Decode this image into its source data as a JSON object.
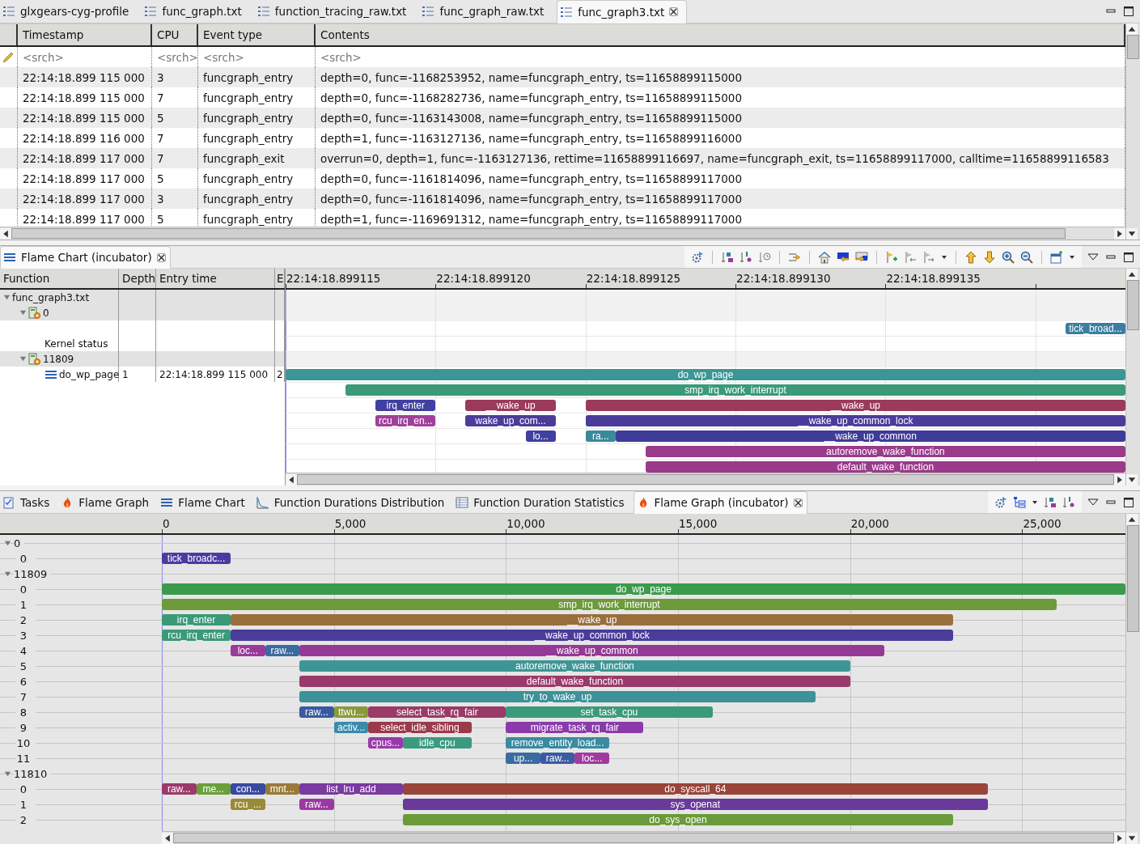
{
  "editor_tabs": [
    {
      "label": "glxgears-cyg-profile",
      "selected": false
    },
    {
      "label": "func_graph.txt",
      "selected": false
    },
    {
      "label": "function_tracing_raw.txt",
      "selected": false
    },
    {
      "label": "func_graph_raw.txt",
      "selected": false
    },
    {
      "label": "func_graph3.txt",
      "selected": true
    }
  ],
  "events_table": {
    "columns": [
      "Timestamp",
      "CPU",
      "Event type",
      "Contents"
    ],
    "filters": [
      "<srch>",
      "<srch>",
      "<srch>",
      "<srch>"
    ],
    "rows": [
      {
        "cells": [
          "22:14:18.899 115 000",
          "3",
          "funcgraph_entry",
          "depth=0, func=-1168253952, name=funcgraph_entry, ts=11658899115000"
        ]
      },
      {
        "cells": [
          "22:14:18.899 115 000",
          "7",
          "funcgraph_entry",
          "depth=0, func=-1168282736, name=funcgraph_entry, ts=11658899115000"
        ]
      },
      {
        "cells": [
          "22:14:18.899 115 000",
          "5",
          "funcgraph_entry",
          "depth=0, func=-1163143008, name=funcgraph_entry, ts=11658899115000"
        ]
      },
      {
        "cells": [
          "22:14:18.899 116 000",
          "7",
          "funcgraph_entry",
          "depth=1, func=-1163127136, name=funcgraph_entry, ts=11658899116000"
        ]
      },
      {
        "cells": [
          "22:14:18.899 117 000",
          "7",
          "funcgraph_exit",
          "overrun=0, depth=1, func=-1163127136, rettime=11658899116697, name=funcgraph_exit, ts=11658899117000, calltime=11658899116583"
        ]
      },
      {
        "cells": [
          "22:14:18.899 117 000",
          "5",
          "funcgraph_entry",
          "depth=0, func=-1161814096, name=funcgraph_entry, ts=11658899117000"
        ]
      },
      {
        "cells": [
          "22:14:18.899 117 000",
          "3",
          "funcgraph_entry",
          "depth=0, func=-1161814096, name=funcgraph_entry, ts=11658899117000"
        ]
      },
      {
        "cells": [
          "22:14:18.899 117 000",
          "5",
          "funcgraph_entry",
          "depth=1, func=-1169691312, name=funcgraph_entry, ts=11658899117000"
        ]
      }
    ]
  },
  "flame_chart_view": {
    "tab": {
      "label": "Flame Chart (incubator)",
      "selected": true
    },
    "columns": [
      "Function",
      "Depth",
      "Entry time",
      "E"
    ],
    "tree": [
      {
        "label": "func_graph3.txt",
        "kind": "trace",
        "expanded": true,
        "children": [
          {
            "label": "0",
            "kind": "thread",
            "expanded": true,
            "children": [
              {
                "label": "Kernel status",
                "kind": "status"
              }
            ]
          },
          {
            "label": "11809",
            "kind": "thread",
            "expanded": true,
            "children": [
              {
                "label": "do_wp_page",
                "kind": "function",
                "depth": "1",
                "entry_time": "22:14:18.899 115 000",
                "column_4": "2"
              }
            ]
          }
        ]
      }
    ],
    "timeline": {
      "ticks": [
        "22:14:18.899115",
        "22:14:18.899120",
        "22:14:18.899125",
        "22:14:18.899130",
        "22:14:18.899135"
      ],
      "rows": [
        {
          "kind": "group",
          "bars": []
        },
        {
          "kind": "group",
          "bars": []
        },
        {
          "kind": "plain",
          "bars": [
            {
              "label": "tick_broad...",
              "color": "#3b7ea1"
            }
          ]
        },
        {
          "kind": "plain",
          "bars": []
        },
        {
          "kind": "group",
          "bars": []
        },
        {
          "kind": "plain",
          "bars": [
            {
              "label": "do_wp_page",
              "color": "#3d9695"
            }
          ]
        },
        {
          "kind": "plain",
          "bars": [
            {
              "label": "smp_irq_work_interrupt",
              "color": "#3b9a78"
            }
          ]
        },
        {
          "kind": "plain",
          "bars": [
            {
              "label": "irq_enter",
              "color": "#4040a0"
            },
            {
              "label": "__wake_up",
              "color": "#9b3a5a"
            },
            {
              "label": "__wake_up",
              "color": "#9b3a5b"
            }
          ]
        },
        {
          "kind": "plain",
          "bars": [
            {
              "label": "rcu_irq_en...",
              "color": "#a0409a"
            },
            {
              "label": "wake_up_com...",
              "color": "#4b3c9a"
            },
            {
              "label": "__wake_up_common_lock",
              "color": "#4b3c9b"
            }
          ]
        },
        {
          "kind": "plain",
          "bars": [
            {
              "label": "lo...",
              "color": "#4040a0"
            },
            {
              "label": "ra...",
              "color": "#3a8a9a"
            },
            {
              "label": "__wake_up_common",
              "color": "#3f3b98"
            }
          ]
        },
        {
          "kind": "plain",
          "bars": [
            {
              "label": "autoremove_wake_function",
              "color": "#9a3a8a"
            }
          ]
        },
        {
          "kind": "plain",
          "bars": [
            {
              "label": "default_wake_function",
              "color": "#9a3a8b"
            }
          ]
        }
      ]
    }
  },
  "bottom_tabs": [
    {
      "label": "Tasks",
      "selected": false
    },
    {
      "label": "Flame Graph",
      "selected": false
    },
    {
      "label": "Flame Chart",
      "selected": false
    },
    {
      "label": "Function Durations Distribution",
      "selected": false
    },
    {
      "label": "Function Duration Statistics",
      "selected": false
    },
    {
      "label": "Flame Graph (incubator)",
      "selected": true
    }
  ],
  "flame_graph": {
    "timeline": {
      "ticks": [
        "0",
        "5,000",
        "10,000",
        "15,000",
        "20,000",
        "25,000"
      ],
      "groups": [
        {
          "label": "0",
          "expanded": true,
          "rows": [
            {
              "label": "0",
              "bars": [
                {
                  "label": "tick_broadc...",
                  "color": "#4b3aa0"
                }
              ]
            }
          ]
        },
        {
          "label": "11809",
          "expanded": true,
          "rows": [
            {
              "label": "0",
              "bars": [
                {
                  "label": "do_wp_page",
                  "color": "#3c9a4c"
                }
              ]
            },
            {
              "label": "1",
              "bars": [
                {
                  "label": "smp_irq_work_interrupt",
                  "color": "#6e9a3c"
                }
              ]
            },
            {
              "label": "2",
              "bars": [
                {
                  "label": "irq_enter",
                  "color": "#3a9a78"
                },
                {
                  "label": "__wake_up",
                  "color": "#9a6e3c"
                }
              ]
            },
            {
              "label": "3",
              "bars": [
                {
                  "label": "rcu_irq_enter",
                  "color": "#3a9a79"
                },
                {
                  "label": "__wake_up_common_lock",
                  "color": "#4b3c9a"
                }
              ]
            },
            {
              "label": "4",
              "bars": [
                {
                  "label": "loc...",
                  "color": "#9a3a9a"
                },
                {
                  "label": "raw...",
                  "color": "#3a6aa0"
                },
                {
                  "label": "__wake_up_common",
                  "color": "#943a96"
                }
              ]
            },
            {
              "label": "5",
              "bars": [
                {
                  "label": "autoremove_wake_function",
                  "color": "#3d9695"
                }
              ]
            },
            {
              "label": "6",
              "bars": [
                {
                  "label": "default_wake_function",
                  "color": "#9a3a6a"
                }
              ]
            },
            {
              "label": "7",
              "bars": [
                {
                  "label": "try_to_wake_up",
                  "color": "#3d9199"
                }
              ]
            },
            {
              "label": "8",
              "bars": [
                {
                  "label": "raw...",
                  "color": "#3a5aa0"
                },
                {
                  "label": "ttwu...",
                  "color": "#8a9a3a"
                },
                {
                  "label": "select_task_rq_fair",
                  "color": "#9a3a66"
                },
                {
                  "label": "set_task_cpu",
                  "color": "#3a9a7a"
                }
              ]
            },
            {
              "label": "9",
              "bars": [
                {
                  "label": "activ...",
                  "color": "#3a8aaa"
                },
                {
                  "label": "select_idle_sibling",
                  "color": "#9a3a4a"
                },
                {
                  "label": "migrate_task_rq_fair",
                  "color": "#8a3aaa"
                }
              ]
            },
            {
              "label": "10",
              "bars": [
                {
                  "label": "cpus...",
                  "color": "#9a3aaa"
                },
                {
                  "label": "idle_cpu",
                  "color": "#3a9a80"
                },
                {
                  "label": "remove_entity_load...",
                  "color": "#3a8aa0"
                }
              ]
            },
            {
              "label": "11",
              "bars": [
                {
                  "label": "up...",
                  "color": "#3a6aa1"
                },
                {
                  "label": "raw...",
                  "color": "#3a5aa2"
                },
                {
                  "label": "loc...",
                  "color": "#a03aa0"
                }
              ]
            }
          ]
        },
        {
          "label": "11810",
          "expanded": true,
          "rows": [
            {
              "label": "0",
              "bars": [
                {
                  "label": "raw...",
                  "color": "#9a3a6b"
                },
                {
                  "label": "me...",
                  "color": "#6aa03a"
                },
                {
                  "label": "con...",
                  "color": "#3a4aa0"
                },
                {
                  "label": "mnt...",
                  "color": "#9a7a3a"
                },
                {
                  "label": "list_lru_add",
                  "color": "#7a3aa0"
                },
                {
                  "label": "do_syscall_64",
                  "color": "#9a443a"
                }
              ]
            },
            {
              "label": "1",
              "bars": [
                {
                  "label": "rcu_...",
                  "color": "#9a8a3a"
                },
                {
                  "label": "raw...",
                  "color": "#9a3aa1"
                },
                {
                  "label": "sys_openat",
                  "color": "#6a3a9a"
                }
              ]
            },
            {
              "label": "2",
              "bars": [
                {
                  "label": "do_sys_open",
                  "color": "#6a9a3a"
                }
              ]
            }
          ]
        }
      ]
    }
  }
}
